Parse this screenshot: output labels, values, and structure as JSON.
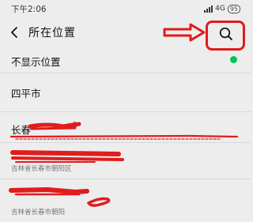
{
  "status": {
    "time": "下午2:06",
    "network": "4G",
    "battery": "95"
  },
  "header": {
    "title": "所在位置"
  },
  "list": {
    "items": [
      {
        "title": "不显示位置",
        "subtitle": "",
        "selected": true
      },
      {
        "title": "四平市",
        "subtitle": ""
      },
      {
        "title": "长春",
        "subtitle": ""
      },
      {
        "title": "",
        "subtitle": "吉林省长春市朝阳区"
      },
      {
        "title": "",
        "subtitle": "吉林省长春市朝阳"
      }
    ]
  },
  "colors": {
    "accent": "#07c160",
    "annotation": "#e01c1c",
    "background": "#ededed"
  },
  "icons": [
    "back-arrow-icon",
    "search-icon",
    "signal-icon",
    "battery-icon",
    "check-icon"
  ]
}
